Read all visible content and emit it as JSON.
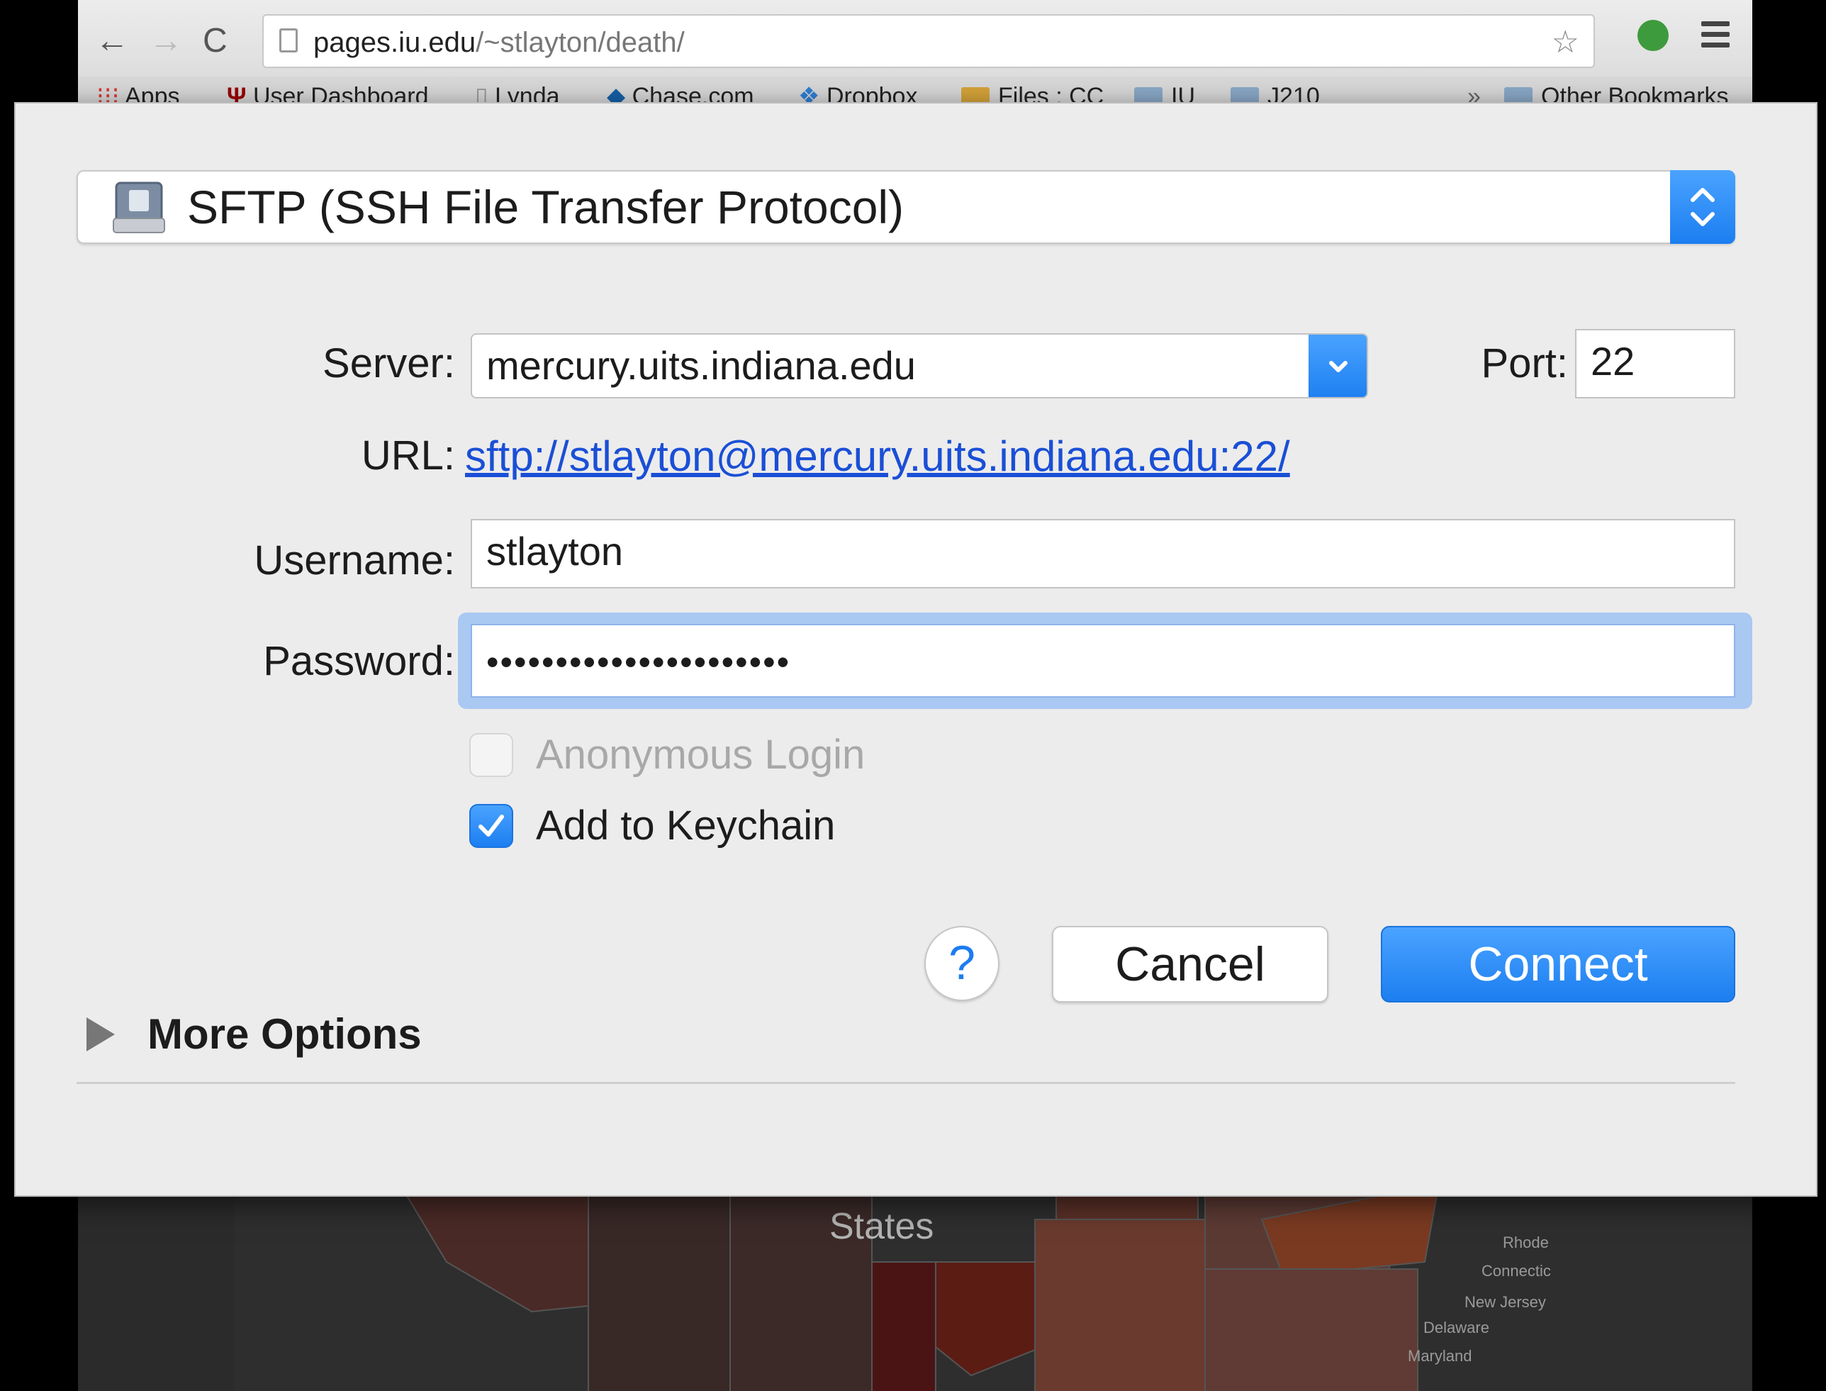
{
  "browser": {
    "url_host": "pages.iu.edu",
    "url_path": "/~stlayton/death/",
    "bookmarks": [
      "Apps",
      "User Dashboard",
      "Lynda",
      "Chase.com",
      "Dropbox",
      "Files : CC",
      "IU",
      "J210"
    ],
    "more_bookmarks": "»",
    "other_bookmarks": "Other Bookmarks",
    "map_heading": "States",
    "map_labels": [
      "Rhode",
      "Connectic",
      "New Jersey",
      "Delaware",
      "Maryland"
    ]
  },
  "dialog": {
    "protocol": "SFTP (SSH File Transfer Protocol)",
    "server_label": "Server:",
    "server_value": "mercury.uits.indiana.edu",
    "port_label": "Port:",
    "port_value": "22",
    "url_label": "URL:",
    "url_value": "sftp://stlayton@mercury.uits.indiana.edu:22/",
    "username_label": "Username:",
    "username_value": "stlayton",
    "password_label": "Password:",
    "password_value": "••••••••••••••••••••••",
    "anonymous_label": "Anonymous Login",
    "anonymous_checked": false,
    "keychain_label": "Add to Keychain",
    "keychain_checked": true,
    "help_label": "?",
    "cancel_label": "Cancel",
    "connect_label": "Connect",
    "more_options_label": "More Options"
  },
  "colors": {
    "accent": "#1c7ef0",
    "link": "#1a4fd6",
    "dialog_bg": "#ececec"
  }
}
